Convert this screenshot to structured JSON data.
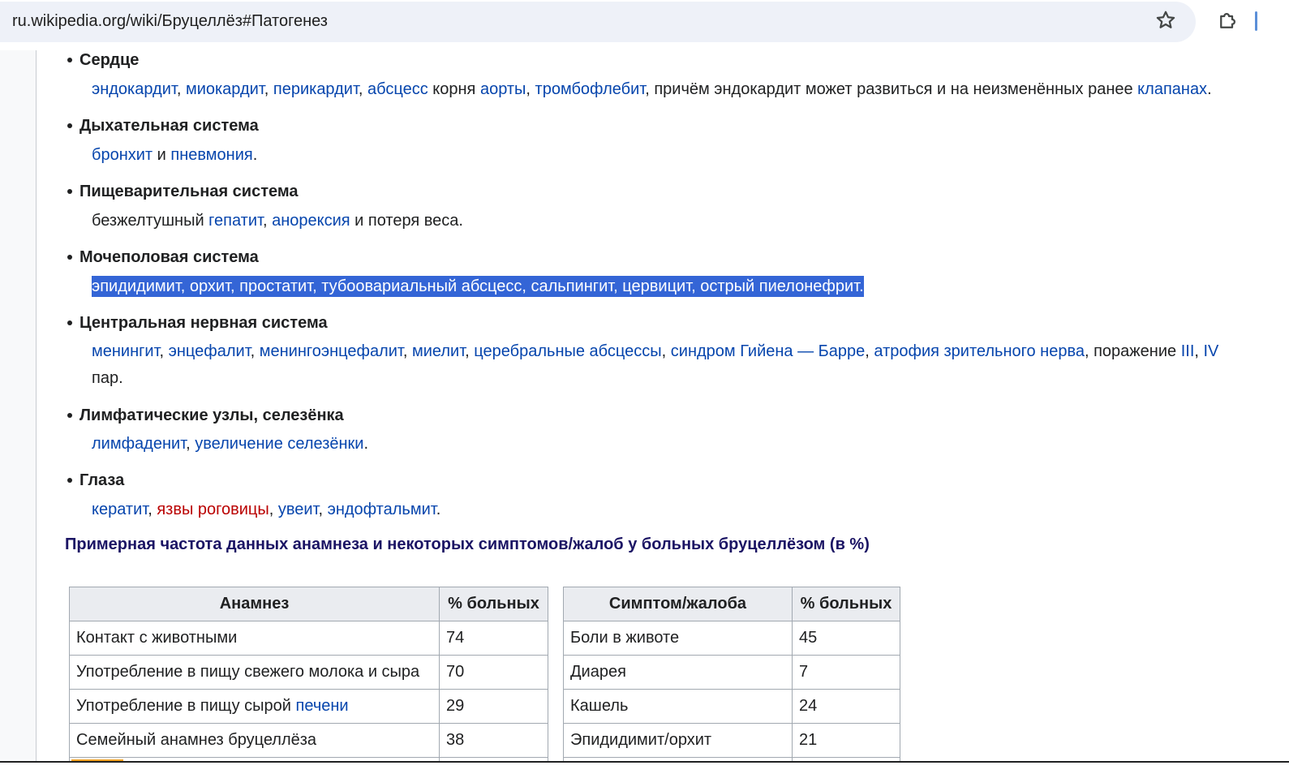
{
  "browser": {
    "url": "ru.wikipedia.org/wiki/Бруцеллёз#Патогенез",
    "bookmark_icon": "star-icon",
    "extensions_icon": "puzzle-icon"
  },
  "sections": [
    {
      "term": "Сердце",
      "parts": [
        {
          "text": "эндокардит",
          "type": "link"
        },
        {
          "text": ", ",
          "type": "text"
        },
        {
          "text": "миокардит",
          "type": "link"
        },
        {
          "text": ", ",
          "type": "text"
        },
        {
          "text": "перикардит",
          "type": "link"
        },
        {
          "text": ", ",
          "type": "text"
        },
        {
          "text": "абсцесс",
          "type": "link"
        },
        {
          "text": " корня ",
          "type": "text"
        },
        {
          "text": "аорты",
          "type": "link"
        },
        {
          "text": ", ",
          "type": "text"
        },
        {
          "text": "тромбофлебит",
          "type": "link"
        },
        {
          "text": ", причём эндокардит может развиться и на неизменённых ранее ",
          "type": "text"
        },
        {
          "text": "клапанах",
          "type": "link"
        },
        {
          "text": ".",
          "type": "text"
        }
      ]
    },
    {
      "term": "Дыхательная система",
      "parts": [
        {
          "text": "бронхит",
          "type": "link"
        },
        {
          "text": " и ",
          "type": "text"
        },
        {
          "text": "пневмония",
          "type": "link"
        },
        {
          "text": ".",
          "type": "text"
        }
      ]
    },
    {
      "term": "Пищеварительная система",
      "parts": [
        {
          "text": "безжелтушный ",
          "type": "text"
        },
        {
          "text": "гепатит",
          "type": "link"
        },
        {
          "text": ", ",
          "type": "text"
        },
        {
          "text": "анорексия",
          "type": "link"
        },
        {
          "text": " и потеря веса.",
          "type": "text"
        }
      ]
    },
    {
      "term": "Мочеполовая система",
      "parts": [
        {
          "text": "эпидидимит, орхит, простатит, тубоовариальный абсцесс, сальпингит, цервицит, острый пиелонефрит.",
          "type": "selected"
        }
      ]
    },
    {
      "term": "Центральная нервная система",
      "parts": [
        {
          "text": "менингит",
          "type": "link"
        },
        {
          "text": ", ",
          "type": "text"
        },
        {
          "text": "энцефалит",
          "type": "link"
        },
        {
          "text": ", ",
          "type": "text"
        },
        {
          "text": "менингоэнцефалит",
          "type": "link"
        },
        {
          "text": ", ",
          "type": "text"
        },
        {
          "text": "миелит",
          "type": "link"
        },
        {
          "text": ", ",
          "type": "text"
        },
        {
          "text": "церебральные абсцессы",
          "type": "link"
        },
        {
          "text": ", ",
          "type": "text"
        },
        {
          "text": "синдром Гийена — Барре",
          "type": "link"
        },
        {
          "text": ", ",
          "type": "text"
        },
        {
          "text": "атрофия зрительного нерва",
          "type": "link"
        },
        {
          "text": ", поражение ",
          "type": "text"
        },
        {
          "text": "III",
          "type": "link"
        },
        {
          "text": ", ",
          "type": "text"
        },
        {
          "text": "IV",
          "type": "link"
        }
      ],
      "continuation": "пар."
    },
    {
      "term": "Лимфатические узлы, селезёнка",
      "parts": [
        {
          "text": "лимфаденит",
          "type": "link"
        },
        {
          "text": ", ",
          "type": "text"
        },
        {
          "text": "увеличение селезёнки",
          "type": "link"
        },
        {
          "text": ".",
          "type": "text"
        }
      ]
    },
    {
      "term": "Глаза",
      "parts": [
        {
          "text": "кератит",
          "type": "link"
        },
        {
          "text": ", ",
          "type": "text"
        },
        {
          "text": "язвы роговицы",
          "type": "redlink"
        },
        {
          "text": ", ",
          "type": "text"
        },
        {
          "text": "увеит",
          "type": "link"
        },
        {
          "text": ", ",
          "type": "text"
        },
        {
          "text": "эндофтальмит",
          "type": "link"
        },
        {
          "text": ".",
          "type": "text"
        }
      ]
    }
  ],
  "caption": "Примерная частота данных анамнеза и некоторых симптомов/жалоб у больных бруцеллёзом (в %)",
  "table_history": {
    "headers": [
      "Анамнез",
      "% больных"
    ],
    "rows": [
      {
        "label": "Контакт с животными",
        "value": "74"
      },
      {
        "label": "Употребление в пищу свежего молока и сыра",
        "value": "70"
      },
      {
        "label": "Употребление в пищу сырой ",
        "link": "печени",
        "value": "29"
      },
      {
        "label": "Семейный анамнез бруцеллёза",
        "value": "38"
      }
    ]
  },
  "table_symptoms": {
    "headers": [
      "Симптом/жалоба",
      "% больных"
    ],
    "rows": [
      {
        "label": "Боли в животе",
        "value": "45"
      },
      {
        "label": "Диарея",
        "value": "7"
      },
      {
        "label": "Кашель",
        "value": "24"
      },
      {
        "label": "Эпидидимит/орхит",
        "value": "21"
      }
    ]
  }
}
